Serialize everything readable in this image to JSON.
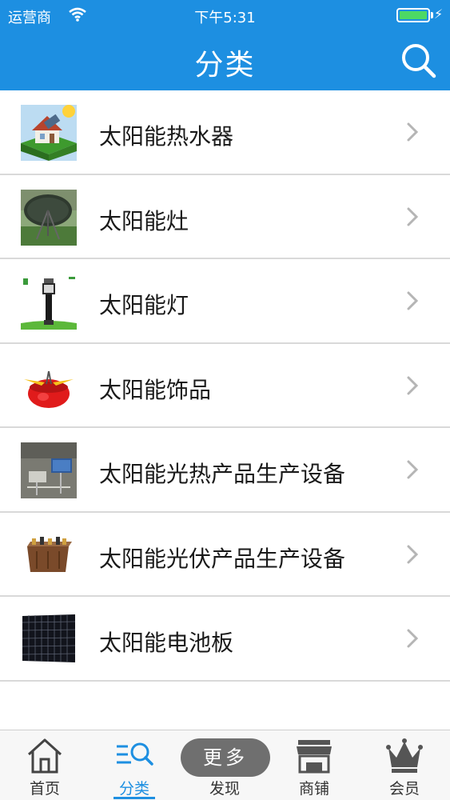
{
  "status_bar": {
    "carrier": "运营商",
    "time": "下午5:31"
  },
  "nav": {
    "title": "分类"
  },
  "categories": [
    {
      "label": "太阳能热水器"
    },
    {
      "label": "太阳能灶"
    },
    {
      "label": "太阳能灯"
    },
    {
      "label": "太阳能饰品"
    },
    {
      "label": "太阳能光热产品生产设备"
    },
    {
      "label": "太阳能光伏产品生产设备"
    },
    {
      "label": "太阳能电池板"
    }
  ],
  "tabbar": {
    "more_label": "更多",
    "tabs": [
      {
        "label": "首页"
      },
      {
        "label": "分类"
      },
      {
        "label": "发现"
      },
      {
        "label": "商铺"
      },
      {
        "label": "会员"
      }
    ]
  },
  "colors": {
    "accent": "#1d8fe1",
    "battery": "#4cd964",
    "divider": "#d9d9d9"
  }
}
